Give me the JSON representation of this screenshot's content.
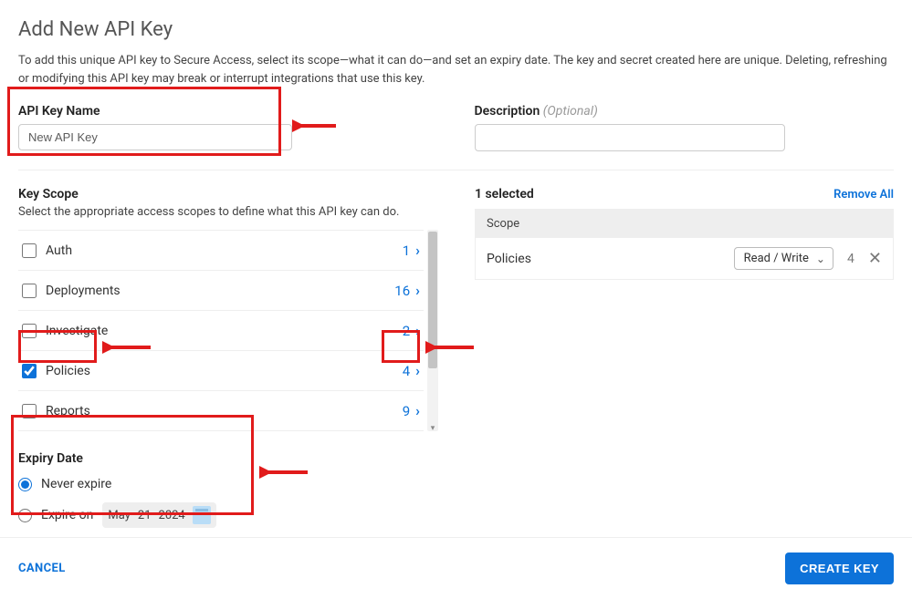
{
  "header": {
    "title": "Add New API Key",
    "description": "To add this unique API key to Secure Access, select its scope—what it can do—and set an expiry date. The key and secret created here are unique. Deleting, refreshing or modifying this API key may break or interrupt integrations that use this key."
  },
  "fields": {
    "name_label": "API Key Name",
    "name_value": "New API Key",
    "desc_label": "Description ",
    "desc_optional": "(Optional)",
    "desc_value": ""
  },
  "scope": {
    "title": "Key Scope",
    "subtitle": "Select the appropriate access scopes to define what this API key can do.",
    "items": [
      {
        "label": "Auth",
        "count": "1",
        "checked": false
      },
      {
        "label": "Deployments",
        "count": "16",
        "checked": false
      },
      {
        "label": "Investigate",
        "count": "2",
        "checked": false
      },
      {
        "label": "Policies",
        "count": "4",
        "checked": true
      },
      {
        "label": "Reports",
        "count": "9",
        "checked": false
      }
    ]
  },
  "selected": {
    "title": "1 selected",
    "remove_all": "Remove All",
    "header": "Scope",
    "rows": [
      {
        "name": "Policies",
        "permission": "Read / Write",
        "count": "4"
      }
    ]
  },
  "expiry": {
    "title": "Expiry Date",
    "never_label": "Never expire",
    "expire_on_label": "Expire on",
    "date_month": "May",
    "date_day": "21",
    "date_year": "2024",
    "selected": "never"
  },
  "footer": {
    "cancel": "CANCEL",
    "create": "CREATE KEY"
  }
}
